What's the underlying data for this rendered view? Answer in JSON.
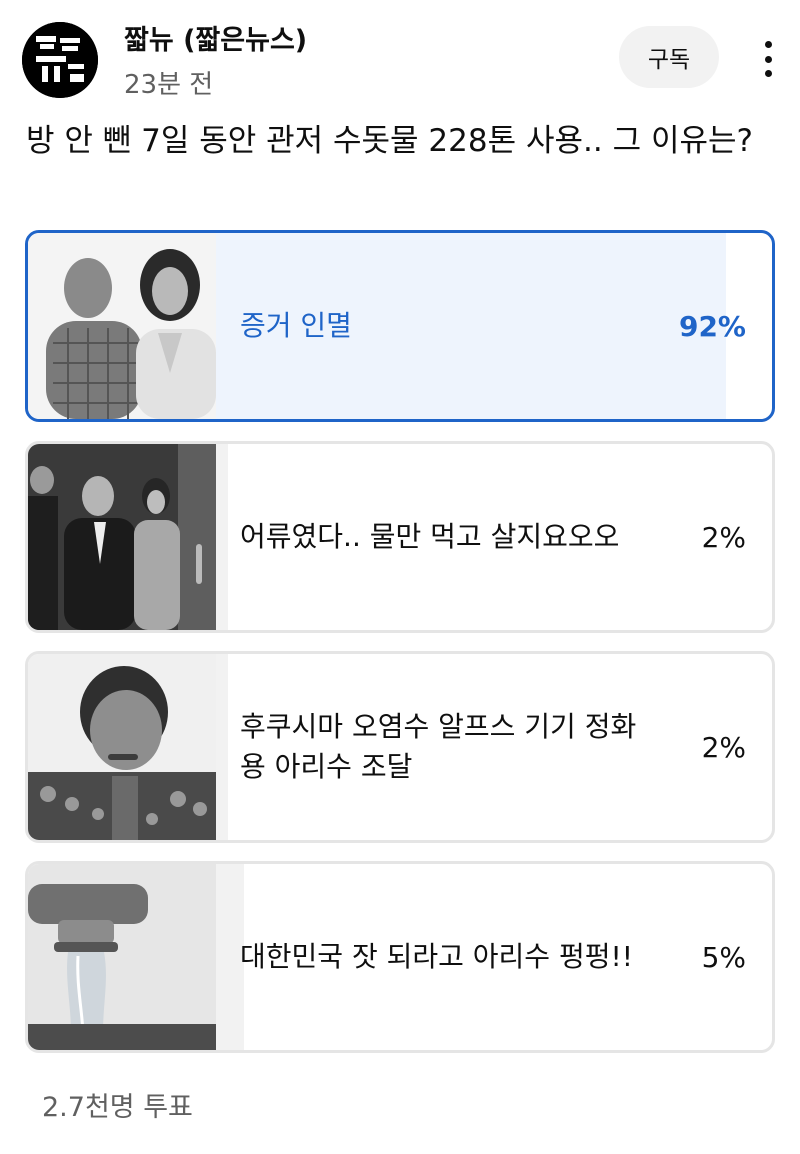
{
  "header": {
    "channel_name": "짧뉴 (짧은뉴스)",
    "time": "23분 전",
    "subscribe_label": "구독",
    "avatar_icon": "channel-logo"
  },
  "poll": {
    "question": "방 안 뺀 7일 동안 관저 수돗물 228톤 사용.. 그 이유는?",
    "options": [
      {
        "label": "증거 인멸",
        "percent": "92%",
        "fraction": 0.92,
        "selected": true,
        "image": "couple-photo"
      },
      {
        "label": "어류였다.. 물만 먹고 살지요오오",
        "percent": "2%",
        "fraction": 0.02,
        "selected": false,
        "image": "group-walking-photo"
      },
      {
        "label": "후쿠시마 오염수 알프스 기기 정화용 아리수 조달",
        "percent": "2%",
        "fraction": 0.02,
        "selected": false,
        "image": "uniform-portrait-photo"
      },
      {
        "label": "대한민국 잣 되라고 아리수 펑펑!!",
        "percent": "5%",
        "fraction": 0.05,
        "selected": false,
        "image": "water-faucet-photo"
      }
    ],
    "vote_count": "2.7천명 투표"
  },
  "colors": {
    "accent": "#1f64c8",
    "selected_fill": "#eef4fd",
    "border": "#e5e5e5",
    "muted_text": "#606060"
  }
}
